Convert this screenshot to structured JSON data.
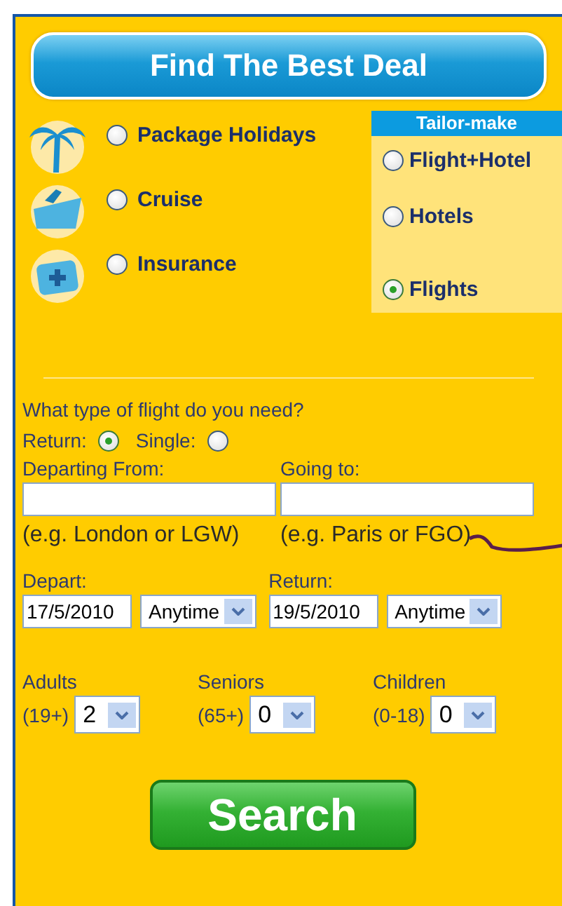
{
  "header": {
    "title": "Find The Best Deal"
  },
  "products": [
    {
      "label": "Package Holidays",
      "selected": false
    },
    {
      "label": "Cruise",
      "selected": false
    },
    {
      "label": "Insurance",
      "selected": false
    }
  ],
  "tailor_make": {
    "title": "Tailor-make",
    "options": [
      {
        "label": "Flight+Hotel",
        "selected": false
      },
      {
        "label": "Hotels",
        "selected": false
      },
      {
        "label": "Flights",
        "selected": true
      }
    ]
  },
  "flight_form": {
    "question": "What type of flight do you need?",
    "trip_types": [
      {
        "label": "Return:",
        "selected": true
      },
      {
        "label": "Single:",
        "selected": false
      }
    ],
    "places": [
      {
        "label": "Departing From:",
        "hint": "(e.g. London or LGW)"
      },
      {
        "label": "Going to:",
        "hint": "(e.g. Paris or FGO)"
      }
    ],
    "dates": [
      {
        "label": "Depart:",
        "date": "17/5/2010",
        "time": "Anytime"
      },
      {
        "label": "Return:",
        "date": "19/5/2010",
        "time": "Anytime"
      }
    ],
    "passengers": [
      {
        "label": "Adults",
        "range": "(19+)",
        "value": "2"
      },
      {
        "label": "Seniors",
        "range": "(65+)",
        "value": "0"
      },
      {
        "label": "Children",
        "range": "(0-18)",
        "value": "0"
      }
    ],
    "search_button": "Search"
  }
}
